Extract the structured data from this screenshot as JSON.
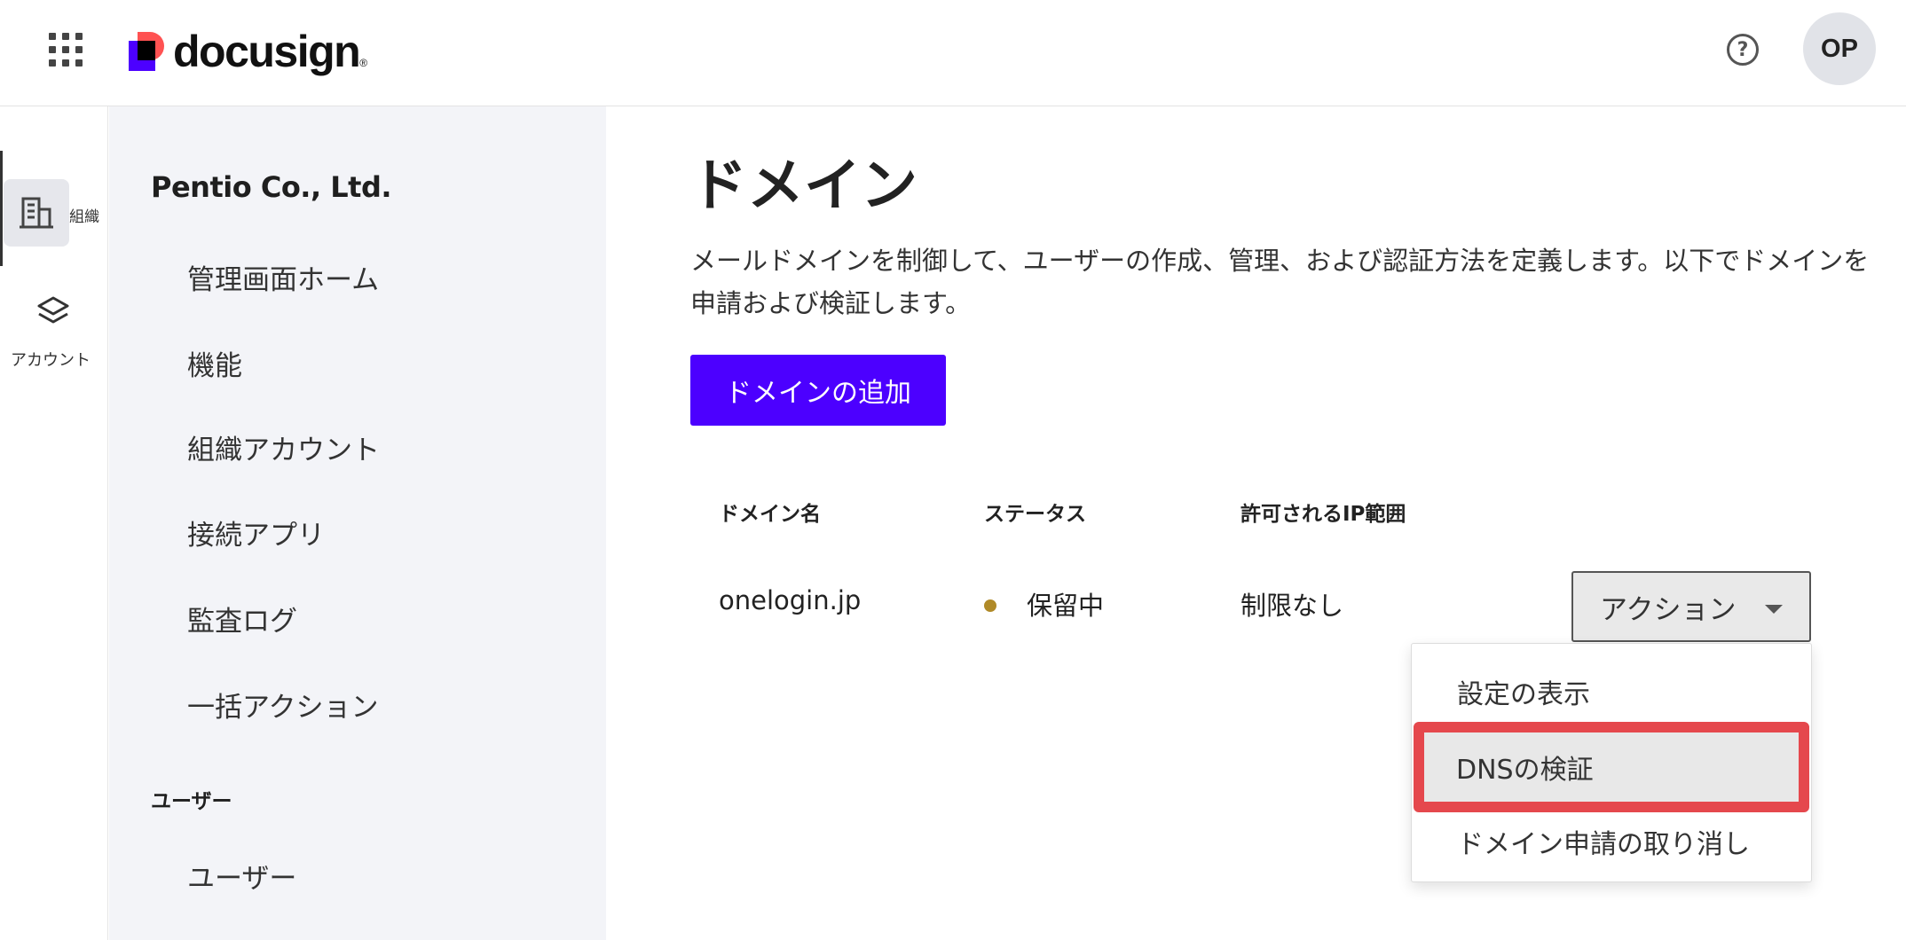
{
  "header": {
    "brand": "docusign",
    "brand_mark": "®",
    "help_label": "?",
    "user_initials": "OP"
  },
  "rail": {
    "org_label": "組織",
    "account_label": "アカウント"
  },
  "sidebar": {
    "org_name": "Pentio Co., Ltd.",
    "items": [
      {
        "label": "管理画面ホーム"
      },
      {
        "label": "機能"
      },
      {
        "label": "組織アカウント"
      },
      {
        "label": "接続アプリ"
      },
      {
        "label": "監査ログ"
      },
      {
        "label": "一括アクション"
      }
    ],
    "section_users": "ユーザー",
    "users_items": [
      {
        "label": "ユーザー"
      }
    ]
  },
  "main": {
    "title": "ドメイン",
    "description": "メールドメインを制御して、ユーザーの作成、管理、および認証方法を定義します。以下でドメインを申請および検証します。",
    "add_button": "ドメインの追加",
    "table": {
      "headers": [
        "ドメイン名",
        "ステータス",
        "許可されるIP範囲"
      ],
      "rows": [
        {
          "domain": "onelogin.jp",
          "status": "保留中",
          "ip_range": "制限なし"
        }
      ]
    },
    "action_button": "アクション",
    "action_menu": [
      "設定の表示",
      "DNSの検証",
      "ドメイン申請の取り消し"
    ]
  },
  "colors": {
    "brand_primary": "#4c00ff",
    "status_pending": "#b08a28",
    "highlight_border": "#e5484d"
  },
  "icons": {
    "apps": "grid-apps-icon",
    "help": "help-circle-icon",
    "org": "building-icon",
    "account": "layers-icon",
    "caret": "caret-down-icon"
  }
}
